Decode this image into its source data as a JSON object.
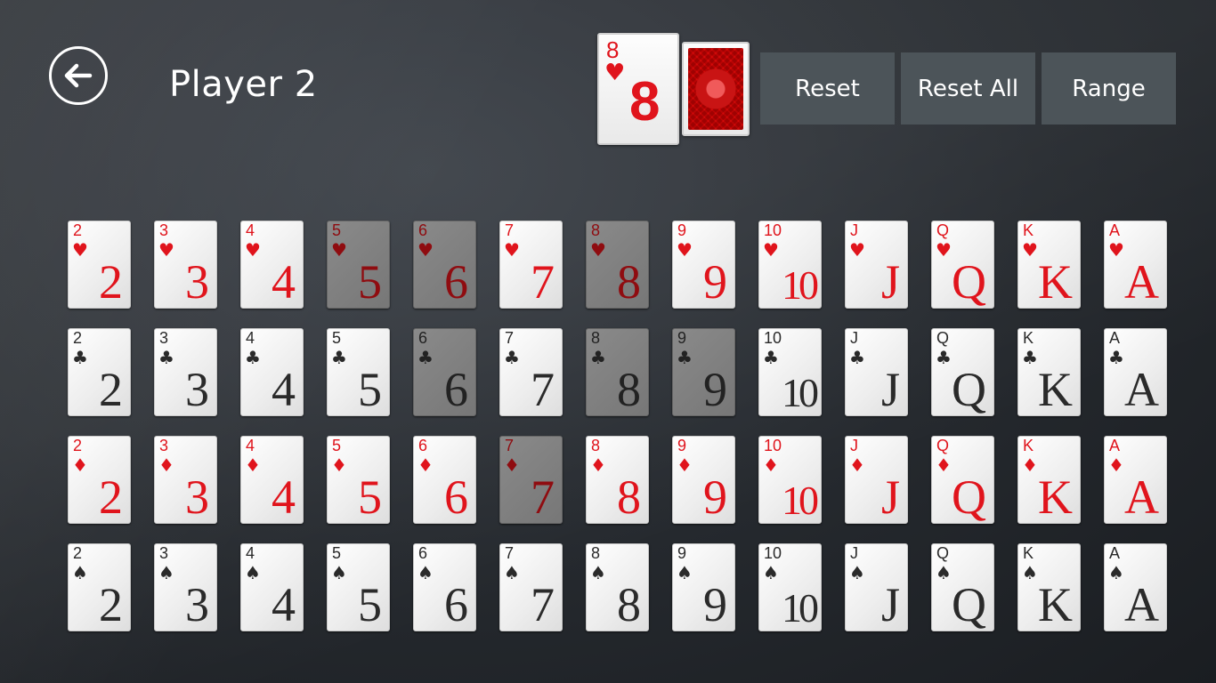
{
  "header": {
    "title": "Player 2",
    "back_icon": "arrow-left-icon"
  },
  "selected_cards": [
    {
      "type": "face",
      "rank": "8",
      "suit": "♥",
      "color": "#e0141c"
    },
    {
      "type": "back",
      "icon": "card-back-pattern",
      "color": "#c91414"
    }
  ],
  "buttons": {
    "reset": "Reset",
    "reset_all": "Reset All",
    "range": "Range"
  },
  "colors": {
    "button_bg": "#4c5459",
    "red_suit": "#e0141c",
    "black_suit": "#2a2a2a",
    "used_card": "#808080"
  },
  "ranks": [
    "2",
    "3",
    "4",
    "5",
    "6",
    "7",
    "8",
    "9",
    "10",
    "J",
    "Q",
    "K",
    "A"
  ],
  "rows": [
    {
      "suit": "♥",
      "name": "hearts",
      "color": "red",
      "used": [
        "5",
        "6",
        "8"
      ]
    },
    {
      "suit": "♣",
      "name": "clubs",
      "color": "black",
      "used": [
        "6",
        "8",
        "9"
      ]
    },
    {
      "suit": "♦",
      "name": "diamonds",
      "color": "red",
      "used": [
        "7"
      ]
    },
    {
      "suit": "♠",
      "name": "spades",
      "color": "black",
      "used": []
    }
  ]
}
